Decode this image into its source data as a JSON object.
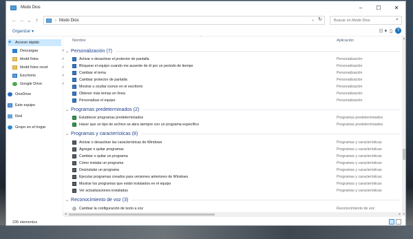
{
  "window": {
    "title": "Modo Dios",
    "minimize": "–",
    "maximize": "☐",
    "close": "✕"
  },
  "navigation": {
    "back": "←",
    "forward": "→",
    "recent": "⌄",
    "up": "↑",
    "breadcrumb_sep": "›",
    "breadcrumb": "Modo Dios",
    "dropdown": "⌄",
    "refresh": "↻",
    "search_placeholder": "Buscar en Modo Dios",
    "search_icon": "⌕"
  },
  "toolbar": {
    "organize_label": "Organizar ▾",
    "view_icon": "☷ ▾",
    "pane_icon": "▯",
    "help_label": "?"
  },
  "sidebar": {
    "items": [
      {
        "label": "Acceso rápido",
        "icon": "star-icon",
        "pinned": false,
        "selected": true
      },
      {
        "label": "Descargas",
        "icon": "download-icon",
        "pinned": true
      },
      {
        "label": "blodd fotos",
        "icon": "folder-icon",
        "pinned": true
      },
      {
        "label": "blodd fotos recet",
        "icon": "folder-icon",
        "pinned": true
      },
      {
        "label": "Escritorio",
        "icon": "desktop-icon",
        "pinned": true
      },
      {
        "label": "Google Drive",
        "icon": "google-drive-icon",
        "pinned": true
      },
      {
        "label": "OneDrive",
        "icon": "onedrive-icon"
      },
      {
        "label": "Este equipo",
        "icon": "computer-icon"
      },
      {
        "label": "Red",
        "icon": "network-icon"
      },
      {
        "label": "Grupo en el hogar",
        "icon": "homegroup-icon"
      }
    ],
    "pin_glyph": "✐"
  },
  "columns": {
    "name": "Nombre",
    "app": "Aplicación",
    "sort": "^"
  },
  "groups": [
    {
      "title": "Personalización (7)",
      "items": [
        {
          "name": "Activar o desactivar el protector de pantalla",
          "app": "Personalización"
        },
        {
          "name": "Bloquear el equipo cuando me ausente de él por un periodo de tiempo",
          "app": "Personalización"
        },
        {
          "name": "Cambiar el tema",
          "app": "Personalización"
        },
        {
          "name": "Cambiar protector de pantalla",
          "app": "Personalización"
        },
        {
          "name": "Mostrar u ocultar iconos en el escritorio",
          "app": "Personalización"
        },
        {
          "name": "Obtener más temas en línea",
          "app": "Personalización"
        },
        {
          "name": "Personalizar el equipo",
          "app": "Personalización"
        }
      ]
    },
    {
      "title": "Programas predeterminados (2)",
      "items": [
        {
          "name": "Establecer programas predeterminados",
          "app": "Programas predeterminados"
        },
        {
          "name": "Hacer que un tipo de archivo se abra siempre con un programa específico",
          "app": "Programas predeterminados"
        }
      ]
    },
    {
      "title": "Programas y características (8)",
      "items": [
        {
          "name": "Activar o desactivar las características de Windows",
          "app": "Programas y características"
        },
        {
          "name": "Agregar o quitar programas",
          "app": "Programas y características"
        },
        {
          "name": "Cambiar o quitar un programa",
          "app": "Programas y características"
        },
        {
          "name": "Cómo instalar un programa",
          "app": "Programas y características"
        },
        {
          "name": "Desinstalar un programa",
          "app": "Programas y características"
        },
        {
          "name": "Ejecutar programas creados para versiones anteriores de Windows",
          "app": "Programas y características"
        },
        {
          "name": "Mostrar los programas que están instalados en el equipo",
          "app": "Programas y características"
        },
        {
          "name": "Ver actualizaciones instaladas",
          "app": "Programas y características"
        }
      ]
    },
    {
      "title": "Reconocimiento de voz (3)",
      "items": [
        {
          "name": "Cambiar la configuración de texto a voz",
          "app": "Reconocimiento de voz"
        }
      ]
    }
  ],
  "scroll": {
    "up": "▲",
    "down": "▼",
    "left": "◂",
    "right": "▸"
  },
  "status": {
    "count": "235 elementos"
  }
}
